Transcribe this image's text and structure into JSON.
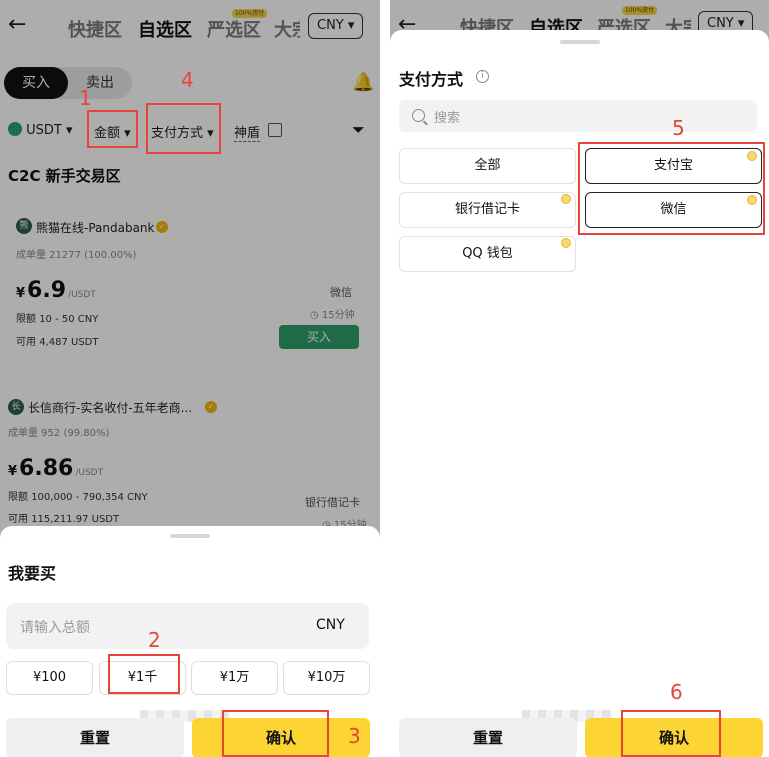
{
  "left": {
    "header": {
      "back": "←",
      "tabs": [
        "快捷区",
        "自选区",
        "严选区",
        "大宗"
      ],
      "tab_badge": "100%资付",
      "currency": "CNY"
    },
    "toggle": {
      "buy": "买入",
      "sell": "卖出"
    },
    "filters": {
      "asset": "USDT",
      "amount": "金额",
      "payment": "支付方式",
      "shendun": "神盾"
    },
    "section_title": "C2C 新手交易区",
    "ads": [
      {
        "merchant": "熊猫在线-Pandabank",
        "stats": "成单量 21277 (100.00%)",
        "currency_symbol": "¥",
        "price": "6.9",
        "unit": "/USDT",
        "limit_label": "限额",
        "limit": "10 - 50 CNY",
        "available_label": "可用",
        "available": "4,487 USDT",
        "payment": "微信",
        "time": "15分钟",
        "action": "买入"
      },
      {
        "merchant": "长信商行-实名收付-五年老商...",
        "stats": "成单量 952 (99.80%)",
        "currency_symbol": "¥",
        "price": "6.86",
        "unit": "/USDT",
        "limit_label": "限额",
        "limit": "100,000 - 790,354 CNY",
        "available_label": "可用",
        "available": "115,211.97 USDT",
        "payment": "银行借记卡",
        "time": "15分钟"
      }
    ],
    "sheet": {
      "title": "我要买",
      "placeholder": "请输入总额",
      "currency": "CNY",
      "chips": [
        "¥100",
        "¥1千",
        "¥1万",
        "¥10万"
      ],
      "reset": "重置",
      "confirm": "确认"
    }
  },
  "right": {
    "header": {
      "back": "←",
      "tabs": [
        "快捷区",
        "自选区",
        "严选区",
        "大宗"
      ],
      "tab_badge": "100%资付",
      "currency": "CNY"
    },
    "sheet": {
      "title": "支付方式",
      "search_placeholder": "搜索",
      "options": [
        "全部",
        "支付宝",
        "银行借记卡",
        "微信",
        "QQ 钱包"
      ],
      "reset": "重置",
      "confirm": "确认"
    }
  },
  "annotations": [
    "1",
    "2",
    "3",
    "4",
    "5",
    "6"
  ],
  "colors": {
    "annotation": "#e8443a",
    "confirm": "#fcd535",
    "buy_green": "#2f9e6b"
  }
}
